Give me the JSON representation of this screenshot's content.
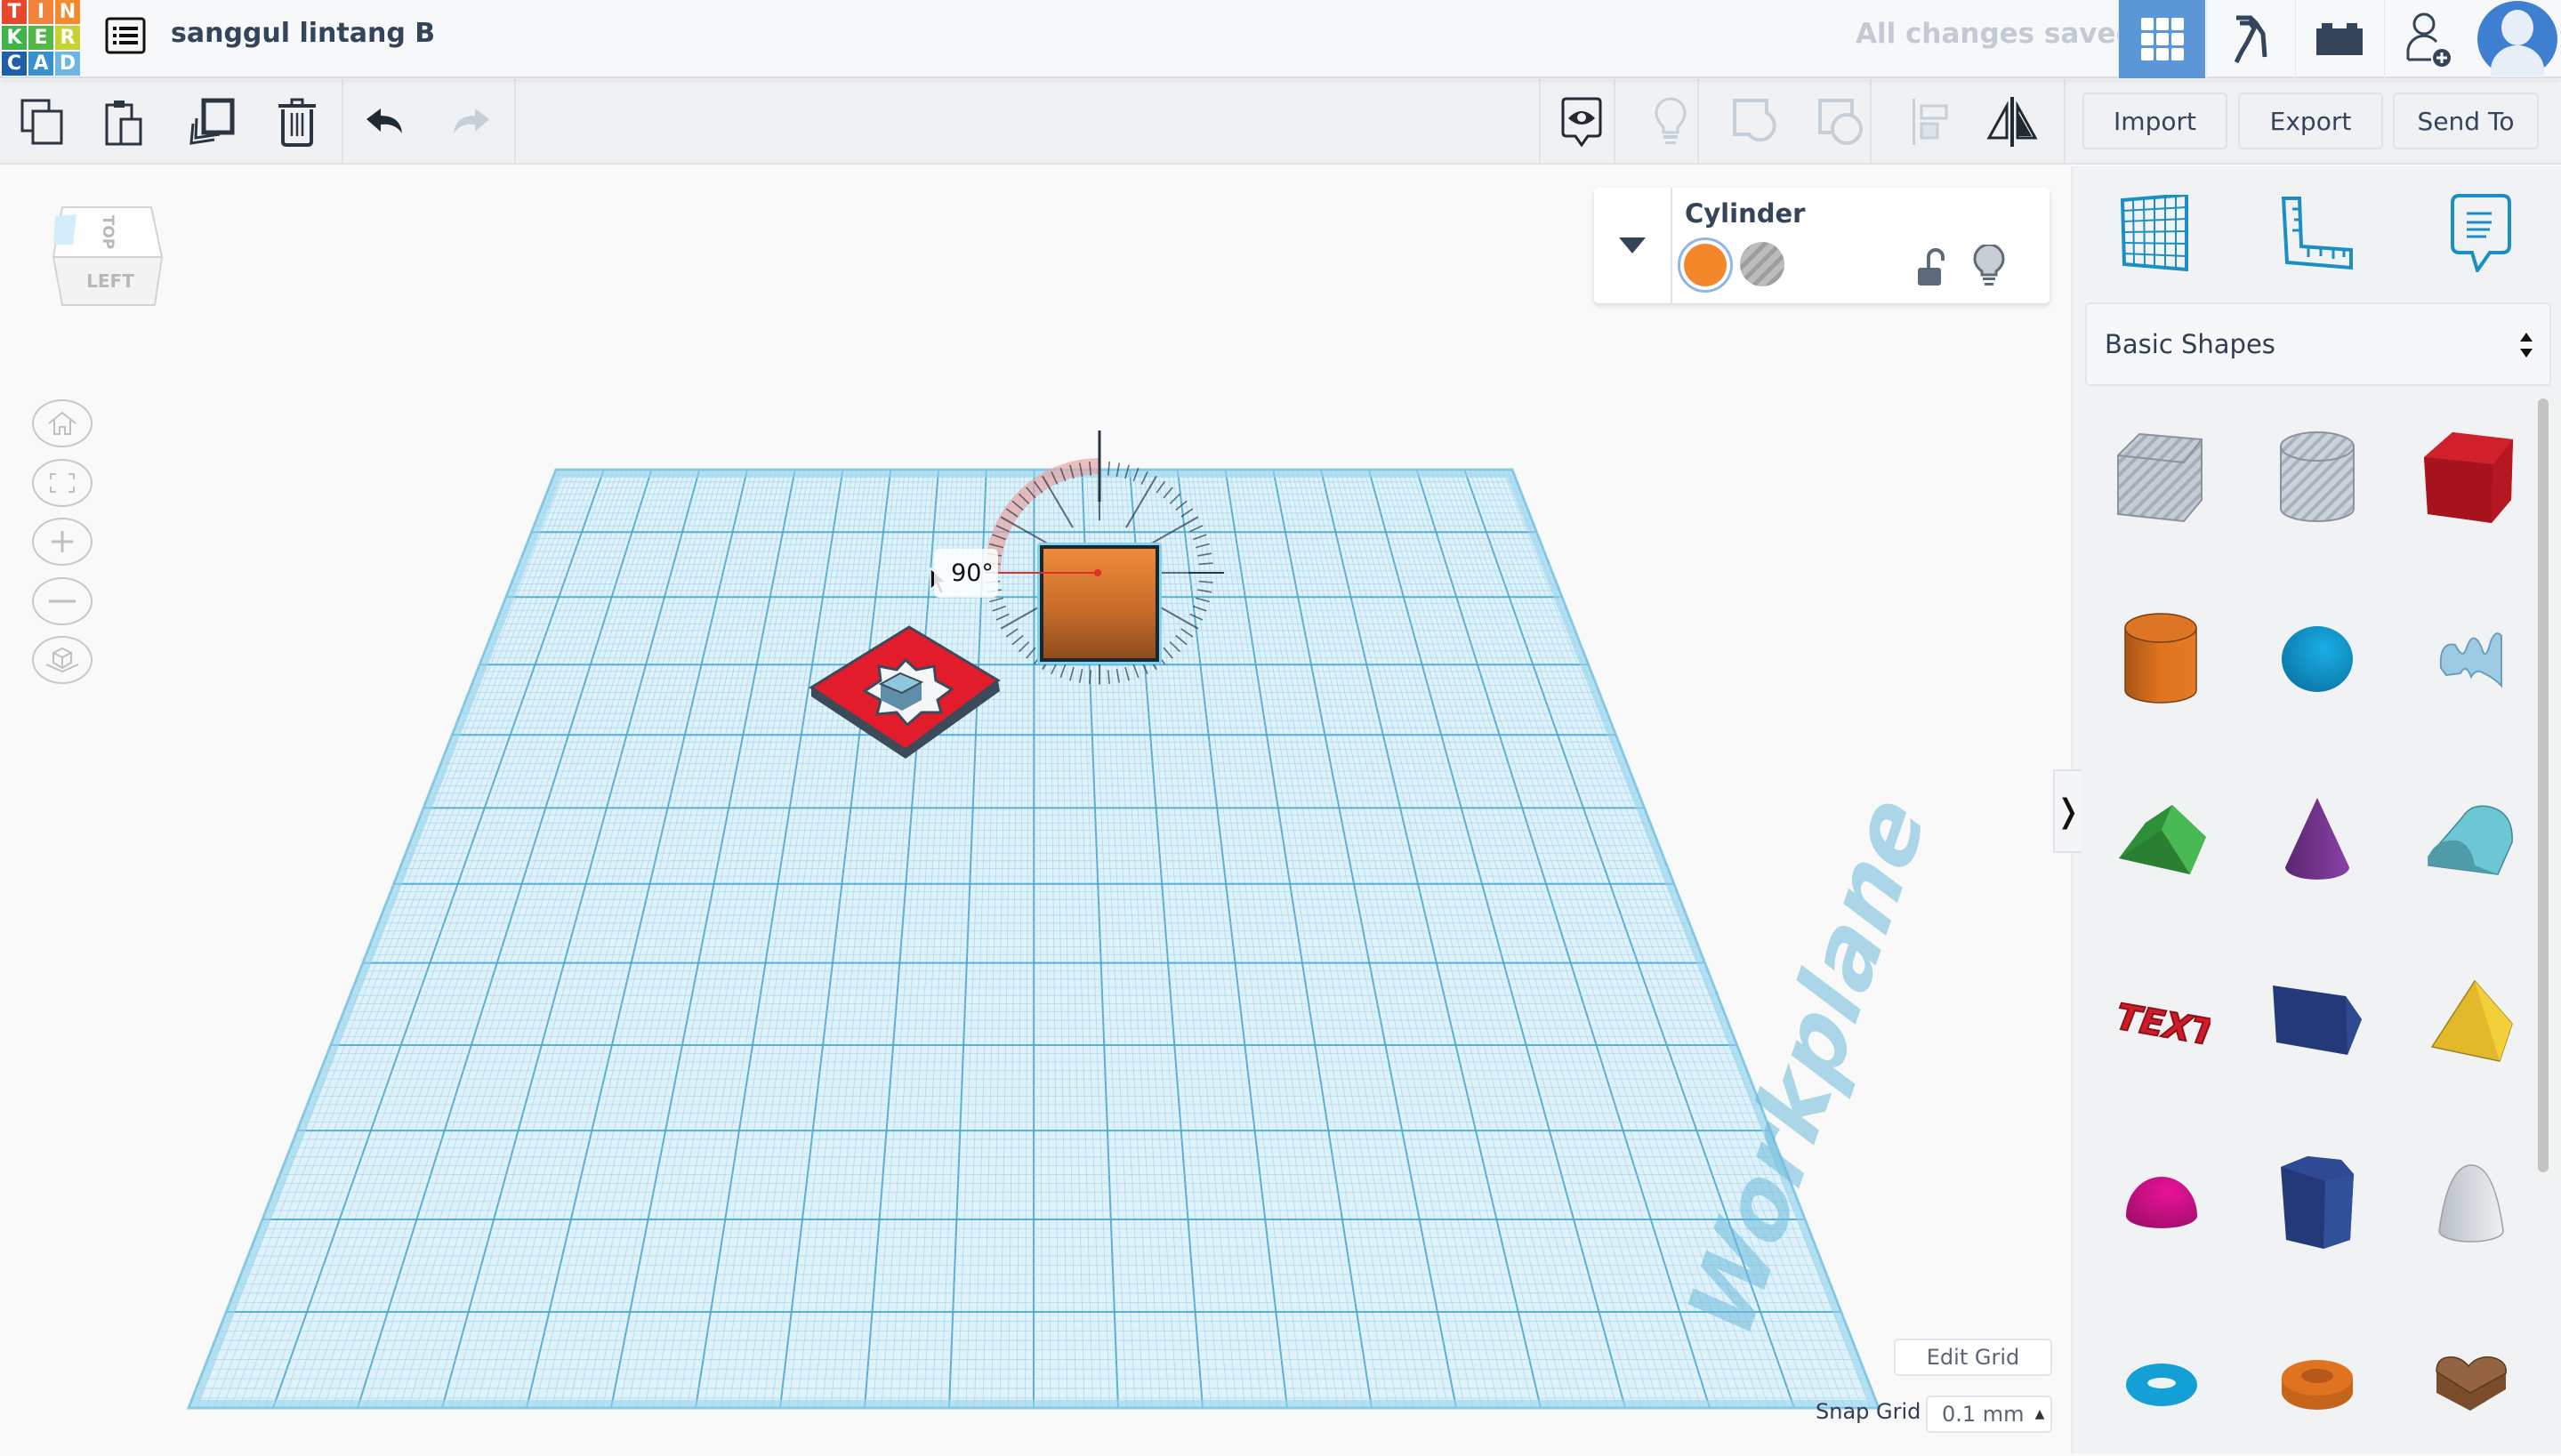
{
  "app": {
    "logo_letters": [
      "T",
      "I",
      "N",
      "K",
      "E",
      "R",
      "C",
      "A",
      "D"
    ],
    "logo_colors": [
      "#e8472e",
      "#f3833a",
      "#f48a2b",
      "#3db54a",
      "#52b848",
      "#c9d235",
      "#1f5fa8",
      "#3a8fcd",
      "#6cb6e1"
    ],
    "design_title": "sanggul lintang B",
    "save_status": "All changes saved",
    "accent_color": "#5b96d6"
  },
  "topnav": {
    "items": [
      {
        "name": "3d-design-view",
        "icon": "grid-icon",
        "active": true
      },
      {
        "name": "circuits",
        "icon": "pickaxe-icon",
        "active": false
      },
      {
        "name": "codeblocks",
        "icon": "brick-icon",
        "active": false
      },
      {
        "name": "invite-user",
        "icon": "add-user-icon",
        "active": false
      },
      {
        "name": "profile",
        "icon": "avatar-icon",
        "active": false
      }
    ]
  },
  "toolbar": {
    "left_tools": [
      {
        "name": "copy",
        "icon": "copy-icon",
        "enabled": true
      },
      {
        "name": "paste",
        "icon": "paste-icon",
        "enabled": true
      },
      {
        "name": "duplicate",
        "icon": "duplicate-icon",
        "enabled": true
      },
      {
        "name": "delete",
        "icon": "trash-icon",
        "enabled": true
      },
      {
        "name": "undo",
        "icon": "undo-icon",
        "enabled": true
      },
      {
        "name": "redo",
        "icon": "redo-icon",
        "enabled": false
      }
    ],
    "right_tools": [
      {
        "name": "notes",
        "icon": "eye-note-icon",
        "enabled": true
      },
      {
        "name": "show-all",
        "icon": "lightbulb-icon",
        "enabled": false
      },
      {
        "name": "group",
        "icon": "group-icon",
        "enabled": false
      },
      {
        "name": "ungroup",
        "icon": "ungroup-icon",
        "enabled": false
      },
      {
        "name": "align",
        "icon": "align-icon",
        "enabled": false
      },
      {
        "name": "mirror",
        "icon": "mirror-icon",
        "enabled": true
      }
    ],
    "import_label": "Import",
    "export_label": "Export",
    "send_to_label": "Send To"
  },
  "viewcube": {
    "top_label": "TOP",
    "front_label": "LEFT"
  },
  "nav_controls": [
    {
      "name": "home-view",
      "icon": "home-icon"
    },
    {
      "name": "fit-view",
      "icon": "fit-icon"
    },
    {
      "name": "zoom-in",
      "icon": "plus-icon"
    },
    {
      "name": "zoom-out",
      "icon": "minus-icon"
    },
    {
      "name": "perspective",
      "icon": "cube-icon"
    }
  ],
  "inspector": {
    "shape_name": "Cylinder",
    "solid_color": "#f5872b",
    "selected": "solid",
    "locked": false
  },
  "viewport": {
    "workplane_label": "Workplane",
    "rotation_angle": "90°",
    "edit_grid_label": "Edit Grid",
    "snap_grid_label": "Snap Grid",
    "snap_grid_value": "0.1 mm"
  },
  "right_panel": {
    "tools": [
      {
        "name": "workplane",
        "icon": "workplane-grid-icon"
      },
      {
        "name": "ruler",
        "icon": "ruler-icon"
      },
      {
        "name": "notes",
        "icon": "note-icon"
      }
    ],
    "library_selected": "Basic Shapes",
    "shapes": [
      {
        "name": "Box Hole",
        "kind": "box-hole"
      },
      {
        "name": "Cylinder Hole",
        "kind": "cylinder-hole"
      },
      {
        "name": "Box",
        "kind": "box",
        "color": "#c8202b"
      },
      {
        "name": "Cylinder",
        "kind": "cylinder",
        "color": "#e0731f"
      },
      {
        "name": "Sphere",
        "kind": "sphere",
        "color": "#0f9ad6"
      },
      {
        "name": "Scribble",
        "kind": "scribble",
        "color": "#8fc3e0"
      },
      {
        "name": "Roof",
        "kind": "roof",
        "color": "#3fae4a"
      },
      {
        "name": "Cone",
        "kind": "cone",
        "color": "#7b3a96"
      },
      {
        "name": "Round Roof",
        "kind": "round-roof",
        "color": "#5bbfcf"
      },
      {
        "name": "Text",
        "kind": "text",
        "color": "#d01c28"
      },
      {
        "name": "Wedge",
        "kind": "wedge",
        "color": "#2d4488"
      },
      {
        "name": "Pyramid",
        "kind": "pyramid",
        "color": "#f0c92e"
      },
      {
        "name": "Half Sphere",
        "kind": "half-sphere",
        "color": "#e0128e"
      },
      {
        "name": "Polygon",
        "kind": "polygon",
        "color": "#2d4488"
      },
      {
        "name": "Paraboloid",
        "kind": "paraboloid",
        "color": "#d8dcdf"
      },
      {
        "name": "Torus",
        "kind": "torus",
        "color": "#12a0d6"
      },
      {
        "name": "Tube",
        "kind": "tube",
        "color": "#e0731f"
      },
      {
        "name": "Heart",
        "kind": "heart",
        "color": "#8c5a36"
      }
    ]
  }
}
